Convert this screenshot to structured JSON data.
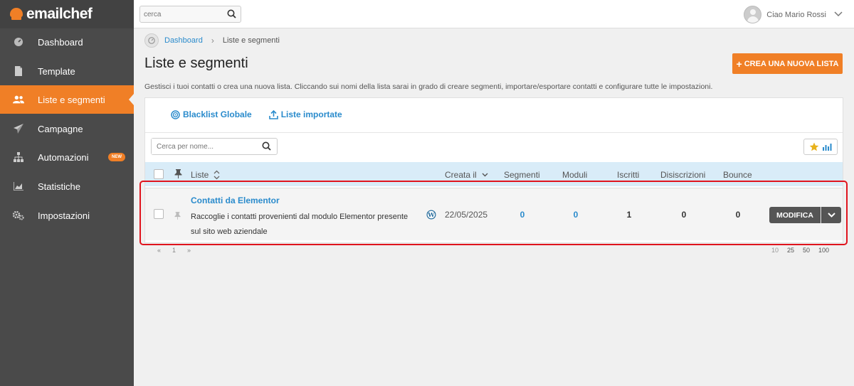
{
  "app": {
    "brand": "emailchef"
  },
  "sidebar": {
    "items": [
      {
        "label": "Dashboard",
        "icon": "gauge-icon"
      },
      {
        "label": "Template",
        "icon": "file-icon"
      },
      {
        "label": "Liste e segmenti",
        "icon": "users-icon",
        "active": true
      },
      {
        "label": "Campagne",
        "icon": "paper-plane-icon"
      },
      {
        "label": "Automazioni",
        "icon": "sitemap-icon",
        "badge": "NEW"
      },
      {
        "label": "Statistiche",
        "icon": "area-chart-icon"
      },
      {
        "label": "Impostazioni",
        "icon": "gears-icon"
      }
    ]
  },
  "topbar": {
    "search_placeholder": "cerca",
    "greeting": "Ciao Mario Rossi"
  },
  "breadcrumb": {
    "home": "Dashboard",
    "current": "Liste e segmenti"
  },
  "page": {
    "title": "Liste e segmenti",
    "create_button": "CREA UNA NUOVA LISTA",
    "description": "Gestisci i tuoi contatti o crea una nuova lista. Cliccando sui nomi della lista sarai in grado di creare segmenti, importare/esportare contatti e configurare tutte le impostazioni."
  },
  "panel": {
    "links": {
      "blacklist": "Blacklist Globale",
      "imported": "Liste importate"
    },
    "search_placeholder": "Cerca per nome...",
    "columns": {
      "list": "Liste",
      "created": "Creata il",
      "segments": "Segmenti",
      "forms": "Moduli",
      "subscribed": "Iscritti",
      "unsubscribed": "Disiscrizioni",
      "bounce": "Bounce"
    },
    "rows": [
      {
        "name": "Contatti da Elementor",
        "description": "Raccoglie i contatti provenienti dal modulo Elementor presente sul sito web aziendale",
        "source_icon": "wordpress-icon",
        "created": "22/05/2025",
        "segments": "0",
        "forms": "0",
        "subscribed": "1",
        "unsubscribed": "0",
        "bounce": "0",
        "edit_label": "MODIFICA"
      }
    ]
  },
  "pagination": {
    "prev": "«",
    "page": "1",
    "next": "»",
    "sizes": [
      "10",
      "25",
      "50",
      "100"
    ]
  },
  "colors": {
    "accent": "#f07f26",
    "link": "#2a8bcc",
    "sidebar": "#4a4a4a",
    "highlight": "#e0141e",
    "header_row": "#d9ecf8"
  }
}
